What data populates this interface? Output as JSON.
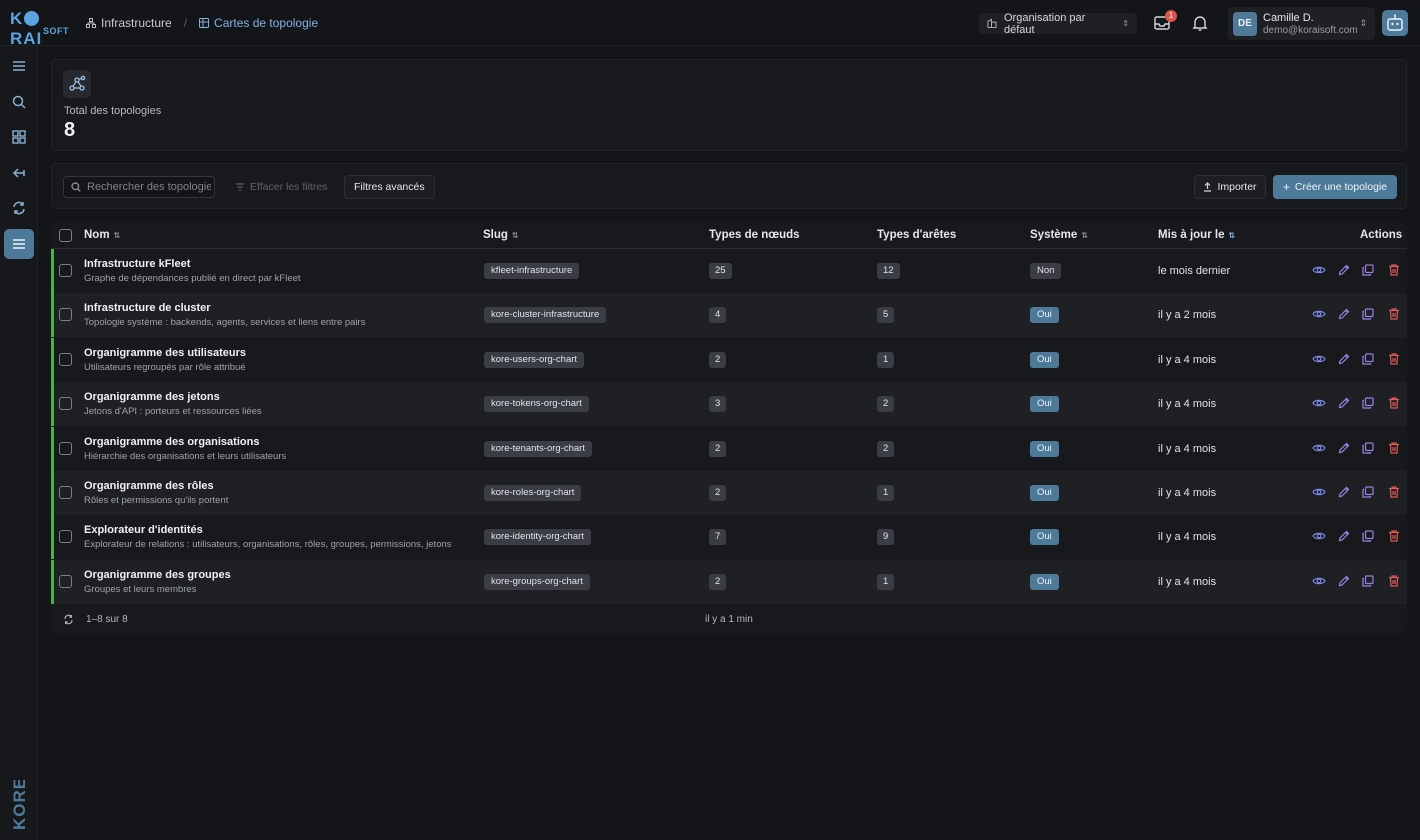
{
  "brand": {
    "logo_top": "K RAI",
    "logo_bottom": "SOFT",
    "sidebar_wordmark": "KORE"
  },
  "breadcrumb": {
    "parent": "Infrastructure",
    "current": "Cartes de topologie"
  },
  "header": {
    "org_select": "Organisation par défaut",
    "inbox_badge": "1",
    "user": {
      "initials": "DE",
      "name": "Camille D.",
      "email": "demo@koraisoft.com"
    }
  },
  "stats": {
    "label": "Total des topologies",
    "value": "8"
  },
  "toolbar": {
    "search_placeholder": "Rechercher des topologies",
    "clear_filters": "Effacer les filtres",
    "advanced_filters": "Filtres avancés",
    "import": "Importer",
    "create": "Créer une topologie"
  },
  "table": {
    "headers": {
      "name": "Nom",
      "slug": "Slug",
      "node_types": "Types de nœuds",
      "edge_types": "Types d'arêtes",
      "system": "Système",
      "updated": "Mis à jour le",
      "actions": "Actions"
    },
    "rows": [
      {
        "title": "Infrastructure kFleet",
        "desc": "Graphe de dépendances publié en direct par kFleet",
        "slug": "kfleet-infrastructure",
        "nodes": "25",
        "edges": "12",
        "system": "Non",
        "updated": "le mois dernier"
      },
      {
        "title": "Infrastructure de cluster",
        "desc": "Topologie système : backends, agents, services et liens entre pairs",
        "slug": "kore-cluster-infrastructure",
        "nodes": "4",
        "edges": "5",
        "system": "Oui",
        "updated": "il y a 2 mois"
      },
      {
        "title": "Organigramme des utilisateurs",
        "desc": "Utilisateurs regroupés par rôle attribué",
        "slug": "kore-users-org-chart",
        "nodes": "2",
        "edges": "1",
        "system": "Oui",
        "updated": "il y a 4 mois"
      },
      {
        "title": "Organigramme des jetons",
        "desc": "Jetons d'API : porteurs et ressources liées",
        "slug": "kore-tokens-org-chart",
        "nodes": "3",
        "edges": "2",
        "system": "Oui",
        "updated": "il y a 4 mois"
      },
      {
        "title": "Organigramme des organisations",
        "desc": "Hiérarchie des organisations et leurs utilisateurs",
        "slug": "kore-tenants-org-chart",
        "nodes": "2",
        "edges": "2",
        "system": "Oui",
        "updated": "il y a 4 mois"
      },
      {
        "title": "Organigramme des rôles",
        "desc": "Rôles et permissions qu'ils portent",
        "slug": "kore-roles-org-chart",
        "nodes": "2",
        "edges": "1",
        "system": "Oui",
        "updated": "il y a 4 mois"
      },
      {
        "title": "Explorateur d'identités",
        "desc": "Explorateur de relations : utilisateurs, organisations, rôles, groupes, permissions, jetons",
        "slug": "kore-identity-org-chart",
        "nodes": "7",
        "edges": "9",
        "system": "Oui",
        "updated": "il y a 4 mois"
      },
      {
        "title": "Organigramme des groupes",
        "desc": "Groupes et leurs membres",
        "slug": "kore-groups-org-chart",
        "nodes": "2",
        "edges": "1",
        "system": "Oui",
        "updated": "il y a 4 mois"
      }
    ],
    "footer": {
      "count": "1–8 sur 8",
      "updated": "il y a 1 min"
    }
  },
  "colors": {
    "accent": "#4e7a99",
    "row_marker": "#4caf50",
    "link": "#7fb3e6",
    "view_icon": "#7b86e8",
    "edit_icon": "#9b86e8",
    "copy_icon": "#9b7fe0",
    "delete_icon": "#e05a5a"
  },
  "icons": {
    "row_actions": [
      "eye-icon",
      "pencil-icon",
      "copy-icon",
      "trash-icon"
    ]
  }
}
